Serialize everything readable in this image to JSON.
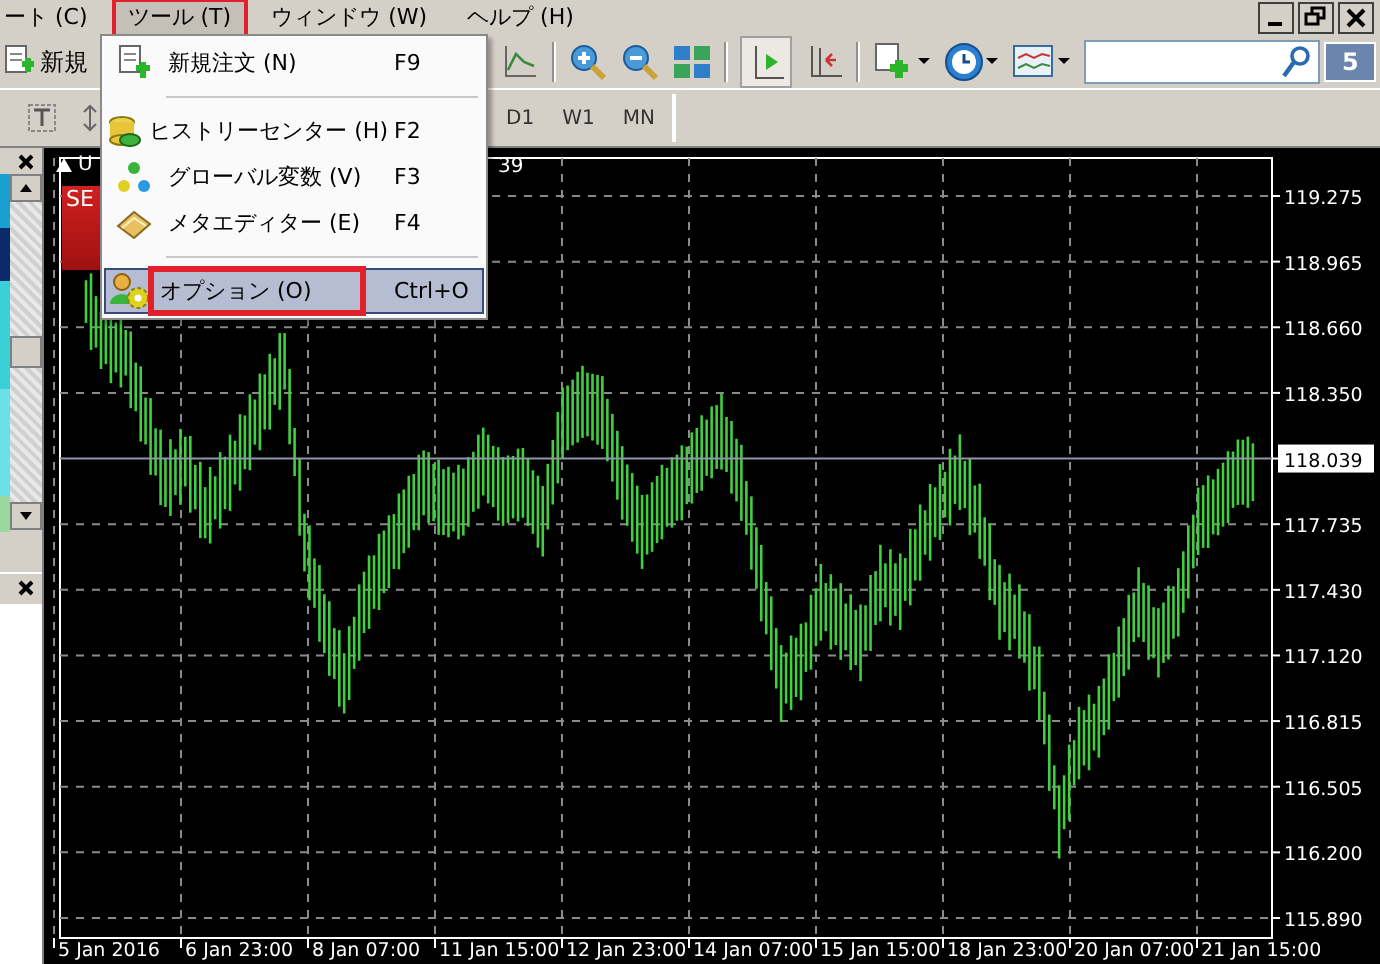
{
  "menubar": [
    {
      "label": "ート (C)",
      "selected": false,
      "marked": false
    },
    {
      "label": "ツール (T)",
      "selected": true,
      "marked": true
    },
    {
      "label": "ウィンドウ (W)",
      "selected": false,
      "marked": false
    },
    {
      "label": "ヘルプ (H)",
      "selected": false,
      "marked": false
    }
  ],
  "toolbar": {
    "new_order_label": "新規",
    "timeframes": [
      "D1",
      "W1",
      "MN"
    ],
    "search": {
      "badge": "5"
    }
  },
  "menu": [
    {
      "kind": "item",
      "label": "新規注文 (N)",
      "shortcut": "F9",
      "selected": false,
      "marked": false
    },
    {
      "kind": "separator"
    },
    {
      "kind": "item",
      "label": "ヒストリーセンター (H)",
      "shortcut": "F2",
      "selected": false,
      "marked": false
    },
    {
      "kind": "item",
      "label": "グローバル変数 (V)",
      "shortcut": "F3",
      "selected": false,
      "marked": false
    },
    {
      "kind": "item",
      "label": "メタエディター (E)",
      "shortcut": "F4",
      "selected": false,
      "marked": false
    },
    {
      "kind": "separator"
    },
    {
      "kind": "item",
      "label": "オプション (O)",
      "shortcut": "Ctrl+O",
      "selected": true,
      "marked": true
    }
  ],
  "chart": {
    "symbol": "U",
    "header_tail": "39",
    "sell_label": "SE",
    "price_axis": [
      {
        "kind": "tick",
        "label": "119.275"
      },
      {
        "kind": "tick",
        "label": "118.965"
      },
      {
        "kind": "tick",
        "label": "118.660"
      },
      {
        "kind": "tick",
        "label": "118.350"
      },
      {
        "kind": "current",
        "label": "118.039"
      },
      {
        "kind": "tick",
        "label": "117.735"
      },
      {
        "kind": "tick",
        "label": "117.430"
      },
      {
        "kind": "tick",
        "label": "117.120"
      },
      {
        "kind": "tick",
        "label": "116.815"
      },
      {
        "kind": "tick",
        "label": "116.505"
      },
      {
        "kind": "tick",
        "label": "116.200"
      },
      {
        "kind": "tick",
        "label": "115.890"
      }
    ],
    "time_axis": [
      "5 Jan 2016",
      "6 Jan 23:00",
      "8 Jan 07:00",
      "11 Jan 15:00",
      "12 Jan 23:00",
      "14 Jan 07:00",
      "15 Jan 15:00",
      "18 Jan 23:00",
      "20 Jan 07:00",
      "21 Jan 15:00"
    ]
  }
}
